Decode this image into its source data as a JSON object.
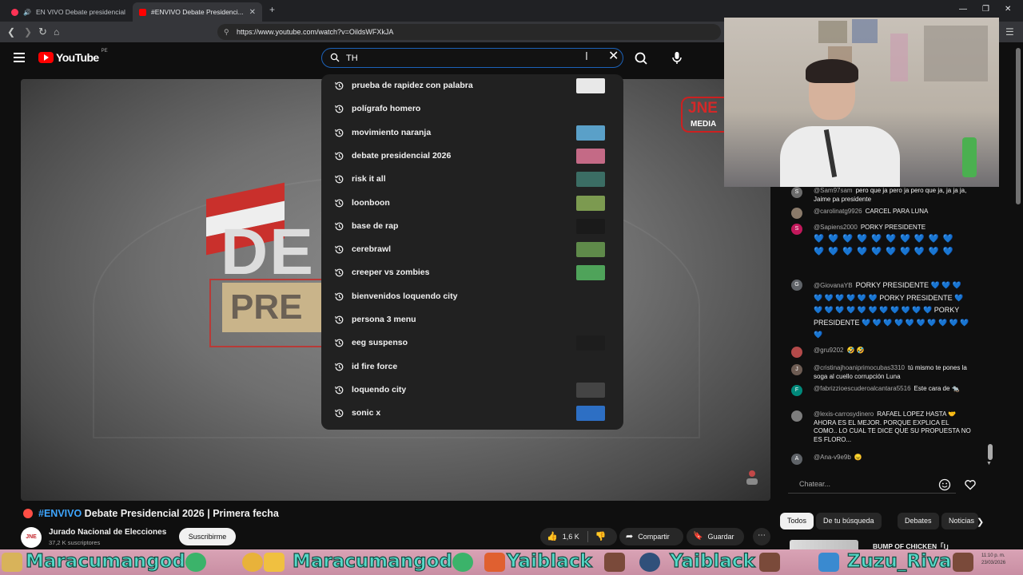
{
  "browser": {
    "tabs": [
      {
        "title": "EN VIVO Debate presidencial",
        "active": false
      },
      {
        "title": "#ENVIVO Debate Presidenci...",
        "active": true
      }
    ],
    "new_tab": "+",
    "url": "https://www.youtube.com/watch?v=OildsWFXkJA"
  },
  "youtube": {
    "logo_text": "YouTube",
    "logo_country": "PE",
    "search": {
      "value": "TH",
      "suggestions": [
        {
          "label": "prueba de rapidez con palabra",
          "thumb": "#e8e8e8"
        },
        {
          "label": "polígrafo homero",
          "thumb": null
        },
        {
          "label": "movimiento naranja",
          "thumb": "#5aa0c8"
        },
        {
          "label": "debate presidencial 2026",
          "thumb": "#c46a86"
        },
        {
          "label": "risk it all",
          "thumb": "#3b6d64"
        },
        {
          "label": "loonboon",
          "thumb": "#7c9a50"
        },
        {
          "label": "base de rap",
          "thumb": "#1a1a1a"
        },
        {
          "label": "cerebrawl",
          "thumb": "#5f8a4a"
        },
        {
          "label": "creeper vs zombies",
          "thumb": "#4fa35a"
        },
        {
          "label": "bienvenidos loquendo city",
          "thumb": null
        },
        {
          "label": "persona 3 menu",
          "thumb": null
        },
        {
          "label": "eeg suspenso",
          "thumb": "#1d1d1d"
        },
        {
          "label": "id fire force",
          "thumb": null
        },
        {
          "label": "loquendo city",
          "thumb": "#444444"
        },
        {
          "label": "sonic x",
          "thumb": "#2d6fc4"
        }
      ]
    }
  },
  "player": {
    "overlay_de": "DE",
    "overlay_pre": "PRE",
    "badge_top": "JNE",
    "badge_bottom": "MEDIA"
  },
  "video": {
    "title_tag": "#ENVIVO",
    "title_rest": "Debate Presidencial 2026 | Primera fecha",
    "channel": "Jurado Nacional de Elecciones",
    "channel_avatar": "JNE",
    "subscribers": "37,2 K suscriptores",
    "subscribe_label": "Suscribirme",
    "likes": "1,6 K",
    "share_label": "Compartir",
    "save_label": "Guardar"
  },
  "chat": {
    "messages": [
      {
        "avatar": "S",
        "avatar_color": "#6b6b6b",
        "user": "@Sam97sam",
        "text": "pero que ja pero ja pero que ja, ja ja ja, Jaime pa presidente"
      },
      {
        "avatar": "",
        "avatar_color": "#8a7a6a",
        "user": "@carolinatg9926",
        "text": "CARCEL PARA LUNA"
      },
      {
        "avatar": "S",
        "avatar_color": "#c2185b",
        "user": "@Sapiens2000",
        "text": "PORKY PRESIDENTE"
      },
      {
        "avatar": "G",
        "avatar_color": "#5f6368",
        "user": "@GiovanaYB",
        "text": "PORKY PRESIDENTE 💙 💙 💙 💙 💙 💙 💙 💙 💙 PORKY PRESIDENTE 💙 💙 💙 💙 💙 💙 💙 💙 💙 💙 💙 💙 PORKY PRESIDENTE 💙 💙 💙 💙 💙 💙 💙 💙 💙 💙 💙"
      },
      {
        "avatar": "",
        "avatar_color": "#b34a4a",
        "user": "@gru9202",
        "text": "🤣 🤣"
      },
      {
        "avatar": "J",
        "avatar_color": "#6d5c53",
        "user": "@cristinajhoaniprimocubas3310",
        "text": "tú mismo te pones la soga al cuello corrupción Luna"
      },
      {
        "avatar": "F",
        "avatar_color": "#00897b",
        "user": "@fabrizzioescuderoalcantara5516",
        "text": "Este cara de 🐀"
      },
      {
        "avatar": "",
        "avatar_color": "#7d7d7d",
        "user": "@lexis-carrosydinero",
        "text": "RAFAEL LOPEZ HASTA 🤝 AHORA ES EL MEJOR. PORQUE EXPLICA EL COMO.. LO CUAL TE DICE QUE SU PROPUESTA NO ES FLORO..."
      },
      {
        "avatar": "A",
        "avatar_color": "#5f6368",
        "user": "@Ana-v9e9b",
        "text": "😠"
      }
    ],
    "hearts_row": "💙 💙 💙 💙 💙 💙 💙 💙 💙 💙",
    "input_placeholder": "Chatear..."
  },
  "chips": [
    "Todos",
    "De tu búsqueda",
    "Debates",
    "Noticias"
  ],
  "recommendation": {
    "title": "BUMP OF CHICKEN「I」"
  },
  "banner": {
    "names": [
      "Maracumangod",
      "Maracumangod",
      "Yaiblack",
      "Yaiblack",
      "Zuzu_Riva"
    ],
    "clock": "11:10 p. m.",
    "date": "23/03/2026"
  },
  "colors": {
    "accent_blue": "#3ea6ff",
    "youtube_red": "#ff0000",
    "search_focus": "#1c62b9",
    "banner_text": "#56d9c8"
  }
}
